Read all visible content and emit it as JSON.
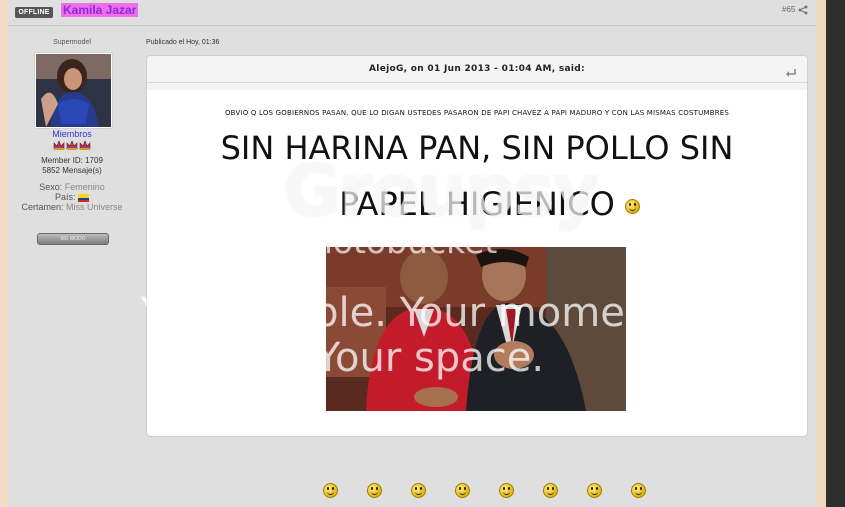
{
  "post": {
    "status_badge": "OFFLINE",
    "author": "Kamila Jazar",
    "post_number": "#65",
    "posted": "Publicado el Hoy, 01:36"
  },
  "profile": {
    "title": "Supermodel",
    "group": "Miembros",
    "member_id": "Member ID: 1709",
    "posts": "5852 Mensaje(s)",
    "sex_label": "Sexo:",
    "sex_value": "Femenino",
    "country_label": "País:",
    "contest_label": "Certamen:",
    "contest_value": "Miss Universe",
    "button": "MG MODO"
  },
  "quote": {
    "header": "AlejoG, on 01 Jun 2013 - 01:04 AM, said:",
    "small_text": "OBVIO Q LOS GOBIERNOS PASAN. QUE LO DIGAN USTEDES PASARON DE PAPI CHAVEZ A PAPI MADURO Y CON LAS MISMAS COSTUMBRES",
    "big_line1": "SIN HARINA PAN, SIN POLLO SIN",
    "big_line2": "PAPEL HIGIENICO"
  },
  "watermark": {
    "logo": "Groupsy",
    "by": "by photobucket",
    "tagline1": "Your people. Your moments.",
    "tagline2": "Your space."
  },
  "icons": {
    "share": "share-icon",
    "quote_return": "return-arrow-icon",
    "smiley": "smiley-icon",
    "rank": "crown-icon"
  },
  "colors": {
    "author_highlight": "#f06ee8",
    "author_text": "#8a2be2",
    "group_link": "#2f37d6",
    "frame_bg": "#dfdfdf",
    "right_bar": "#2e2e2e"
  },
  "emoticon_row_count": 8
}
